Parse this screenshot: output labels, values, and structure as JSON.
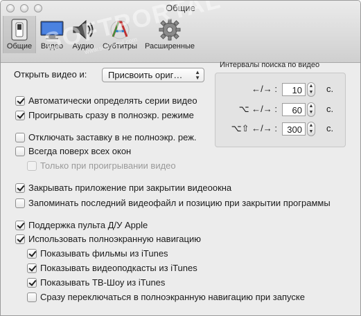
{
  "window": {
    "title": "Общие"
  },
  "toolbar": {
    "items": [
      {
        "label": "Общие",
        "icon": "switch-icon"
      },
      {
        "label": "Видео",
        "icon": "display-icon"
      },
      {
        "label": "Аудио",
        "icon": "speaker-icon"
      },
      {
        "label": "Субтитры",
        "icon": "subtitles-icon"
      },
      {
        "label": "Расширенные",
        "icon": "gear-icon"
      }
    ]
  },
  "watermark": {
    "text": "SOFTPORTAL",
    "url": "www.softportal.com",
    "mark": "TM"
  },
  "open_video": {
    "label": "Открыть видео и:",
    "value": "Присвоить ориг…"
  },
  "seek": {
    "title": "Интервалы поиска по видео",
    "rows": [
      {
        "label": "←/→ :",
        "value": "10",
        "unit": "с."
      },
      {
        "label": "⌥ ←/→ :",
        "value": "60",
        "unit": "с."
      },
      {
        "label": "⌥⇧ ←/→ :",
        "value": "300",
        "unit": "с."
      }
    ]
  },
  "options": [
    {
      "label": "Автоматически определять серии видео",
      "checked": true,
      "disabled": false
    },
    {
      "label": "Проигрывать сразу в полноэкр. режиме",
      "checked": true,
      "disabled": false
    },
    {
      "label": "Отключать заставку в не полноэкр. реж.",
      "checked": false,
      "disabled": false
    },
    {
      "label": "Всегда поверх всех окон",
      "checked": false,
      "disabled": false
    },
    {
      "label": "Только при проигрывании видео",
      "checked": false,
      "disabled": true
    },
    {
      "label": "Закрывать приложение при закрытии видеоокна",
      "checked": true,
      "disabled": false
    },
    {
      "label": "Запоминать последний видеофайл и позицию при закрытии программы",
      "checked": false,
      "disabled": false
    },
    {
      "label": "Поддержка пульта Д/У Apple",
      "checked": true,
      "disabled": false
    },
    {
      "label": "Использовать полноэкранную навигацию",
      "checked": true,
      "disabled": false
    },
    {
      "label": "Показывать фильмы из iTunes",
      "checked": true,
      "disabled": false
    },
    {
      "label": "Показывать видеоподкасты из iTunes",
      "checked": true,
      "disabled": false
    },
    {
      "label": "Показывать ТВ-Шоу из iTunes",
      "checked": true,
      "disabled": false
    },
    {
      "label": "Сразу переключаться в полноэкранную навигацию при запуске",
      "checked": false,
      "disabled": false
    }
  ]
}
